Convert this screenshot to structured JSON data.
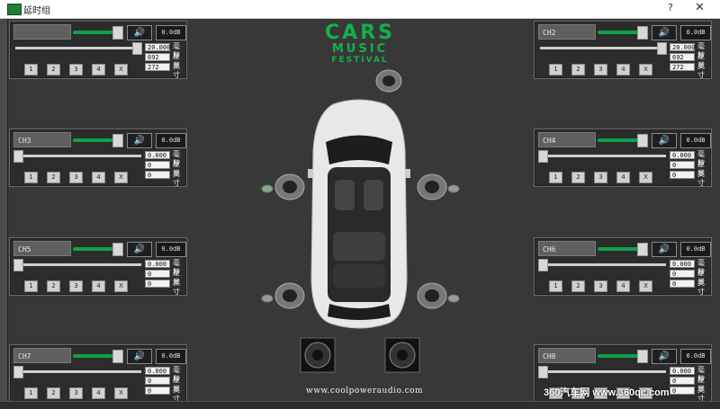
{
  "window": {
    "title": "延时组",
    "help": "?",
    "close": "✕"
  },
  "logo": {
    "line1": "CARS",
    "line2": "MUSIC",
    "line3": "FESTIVAL"
  },
  "website": "www.coolpoweraudio.com",
  "watermark": "360汽车网 www.360qc.com",
  "units": {
    "ms": "毫秒",
    "cm": "厘米",
    "inch": "英寸"
  },
  "buttons": [
    "1",
    "2",
    "3",
    "4",
    "X"
  ],
  "icons": {
    "speaker": "speaker-volume-icon"
  },
  "colors": {
    "accent": "#14b04a",
    "panel": "#2c2c2c",
    "background": "#383838"
  },
  "channels": [
    {
      "name": "",
      "db": "0.0dB",
      "ms": "20.000",
      "cm": "692",
      "inch": "272",
      "delay_fraction": 1.0
    },
    {
      "name": "CH2",
      "db": "0.0dB",
      "ms": "20.000",
      "cm": "692",
      "inch": "272",
      "delay_fraction": 1.0
    },
    {
      "name": "CH3",
      "db": "0.0dB",
      "ms": "0.000",
      "cm": "0",
      "inch": "0",
      "delay_fraction": 0.0
    },
    {
      "name": "CH4",
      "db": "0.0dB",
      "ms": "0.000",
      "cm": "0",
      "inch": "0",
      "delay_fraction": 0.0
    },
    {
      "name": "CH5",
      "db": "0.0dB",
      "ms": "0.000",
      "cm": "0",
      "inch": "0",
      "delay_fraction": 0.0
    },
    {
      "name": "CH6",
      "db": "0.0dB",
      "ms": "0.000",
      "cm": "0",
      "inch": "0",
      "delay_fraction": 0.0
    },
    {
      "name": "CH7",
      "db": "0.0dB",
      "ms": "0.000",
      "cm": "0",
      "inch": "0",
      "delay_fraction": 0.0
    },
    {
      "name": "CH8",
      "db": "0.0dB",
      "ms": "0.000",
      "cm": "0",
      "inch": "0",
      "delay_fraction": 0.0
    }
  ]
}
